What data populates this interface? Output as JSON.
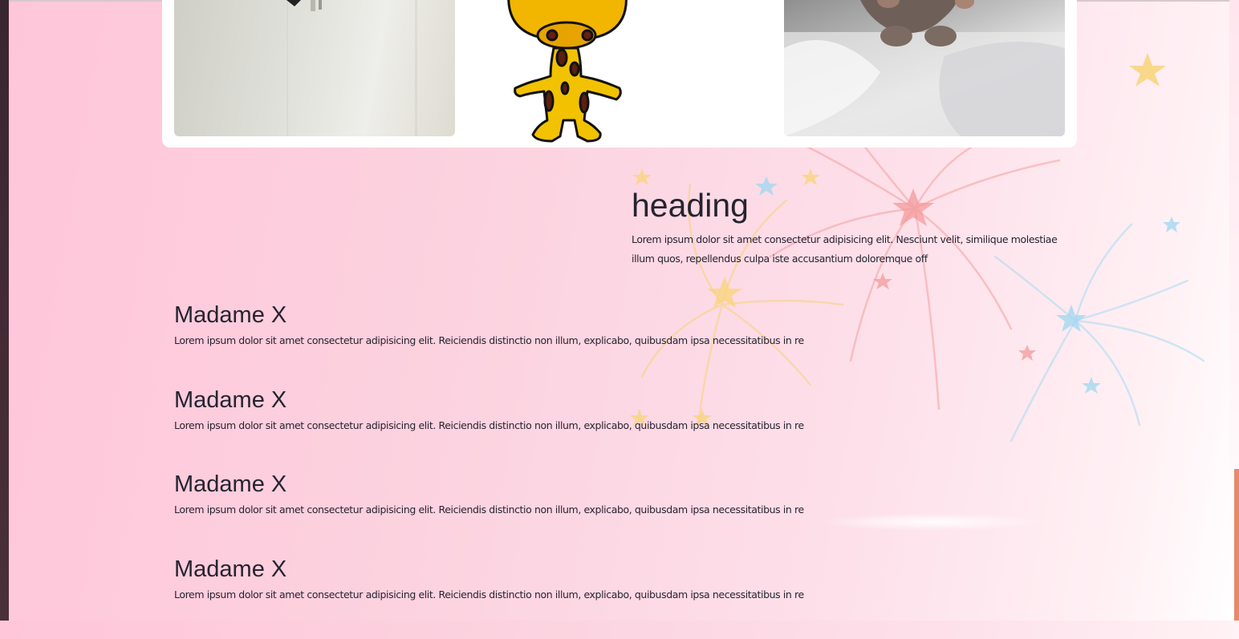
{
  "feature": {
    "heading": "heading",
    "text": "Lorem ipsum dolor sit amet consectetur adipisicing elit. Nesciunt velit, similique molestiae illum quos, repellendus culpa iste accusantium doloremque off"
  },
  "items": [
    {
      "title": "Madame X",
      "text": "Lorem ipsum dolor sit amet consectetur adipisicing elit. Reiciendis distinctio non illum, explicabo, quibusdam ipsa necessitatibus in re"
    },
    {
      "title": "Madame X",
      "text": "Lorem ipsum dolor sit amet consectetur adipisicing elit. Reiciendis distinctio non illum, explicabo, quibusdam ipsa necessitatibus in re"
    },
    {
      "title": "Madame X",
      "text": "Lorem ipsum dolor sit amet consectetur adipisicing elit. Reiciendis distinctio non illum, explicabo, quibusdam ipsa necessitatibus in re"
    },
    {
      "title": "Madame X",
      "text": "Lorem ipsum dolor sit amet consectetur adipisicing elit. Reiciendis distinctio non illum, explicabo, quibusdam ipsa necessitatibus in re"
    }
  ],
  "colors": {
    "background": "#fcd3e0",
    "text": "#252430",
    "scroll_thumb": "#e58a6a",
    "card": "#ffffff"
  },
  "icons": [
    "giraffe-cartoon-image",
    "fireworks-stars-decoration"
  ]
}
